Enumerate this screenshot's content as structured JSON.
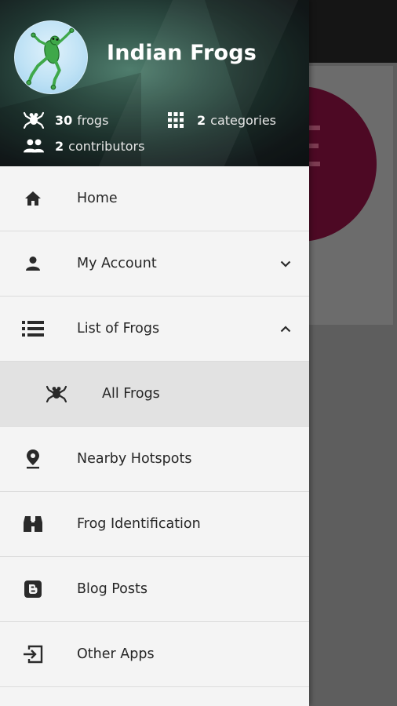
{
  "header": {
    "title": "Indian Frogs",
    "stats": {
      "frogs_count": "30",
      "frogs_label": "frogs",
      "categories_count": "2",
      "categories_label": "categories",
      "contributors_count": "2",
      "contributors_label": "contributors"
    }
  },
  "menu": {
    "items": [
      {
        "label": "Home",
        "icon": "home-icon"
      },
      {
        "label": "My Account",
        "icon": "person-icon",
        "chevron": "chevron-down-icon"
      },
      {
        "label": "List of Frogs",
        "icon": "list-icon",
        "chevron": "chevron-up-icon",
        "expanded": true
      },
      {
        "label": "All Frogs",
        "icon": "frog-icon",
        "sub": true,
        "selected": true
      },
      {
        "label": "Nearby Hotspots",
        "icon": "location-pin-icon"
      },
      {
        "label": "Frog Identification",
        "icon": "binoculars-icon"
      },
      {
        "label": "Blog Posts",
        "icon": "blogger-icon"
      },
      {
        "label": "Other Apps",
        "icon": "exit-icon"
      }
    ]
  },
  "colors": {
    "drawer_bg": "#f4f4f4",
    "selected_bg": "#e2e2e2",
    "accent_circle": "#4d0924",
    "text": "#262626"
  }
}
